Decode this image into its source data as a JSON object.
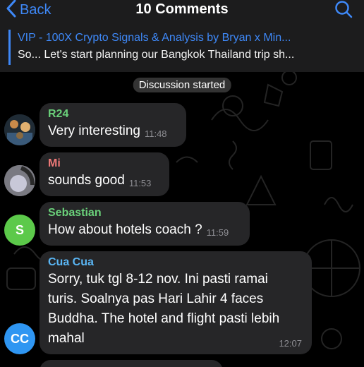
{
  "header": {
    "back_label": "Back",
    "title": "10 Comments",
    "pinned_title": "VIP - 100X Crypto Signals & Analysis by Bryan x Min...",
    "pinned_text": "So... Let's start planning our Bangkok Thailand trip sh..."
  },
  "service_message": "Discussion started",
  "messages": [
    {
      "sender": "R24",
      "text": "Very interesting",
      "time": "11:48"
    },
    {
      "sender": "Mi",
      "text": "sounds good",
      "time": "11:53"
    },
    {
      "sender": "Sebastian",
      "avatar_initials": "S",
      "text": "How about hotels coach ?",
      "time": "11:59"
    },
    {
      "sender": "Cua Cua",
      "avatar_initials": "CC",
      "text_lines": [
        "Sorry, tuk tgl 8-12 nov. Ini pasti ramai",
        "turis. Soalnya pas Hari Lahir 4 faces",
        "Buddha. The hotel and flight pasti lebih",
        "mahal"
      ],
      "time": "12:07"
    }
  ],
  "colors": {
    "accent": "#3e88f7",
    "sender_r24": "#6ad07a",
    "sender_mi": "#f07a79",
    "sender_sebastian": "#6ad07a",
    "sender_cuacua": "#5ab6f5",
    "avatar_s": "#5cc94a",
    "avatar_cc": "#2f96f2"
  },
  "icons": {
    "back": "chevron-left-icon",
    "search": "search-icon"
  }
}
